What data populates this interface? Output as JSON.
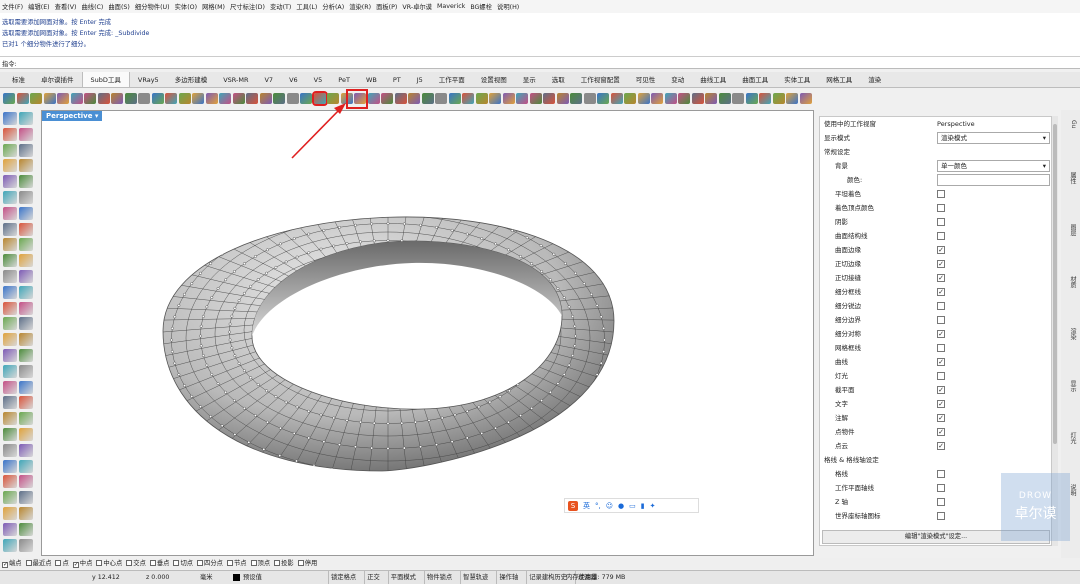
{
  "menu": [
    "文件(F)",
    "编辑(E)",
    "查看(V)",
    "曲线(C)",
    "曲面(S)",
    "细分物件(U)",
    "实体(O)",
    "网格(M)",
    "尺寸标注(D)",
    "变动(T)",
    "工具(L)",
    "分析(A)",
    "渲染(R)",
    "面板(P)",
    "VR-卓尔谟",
    "Maverick",
    "BG螺栓",
    "说明(H)"
  ],
  "command_history": [
    "选取需要添加网面对象。按 Enter 完成",
    "选取需要添加网面对象。按 Enter 完成: _Subdivide",
    "已对1 个细分物件进行了细分。"
  ],
  "command_prompt": "指令:",
  "tabs": [
    "标准",
    "卓尔谟插件",
    "SubD工具",
    "VRay5",
    "多边形建模",
    "VSR-MR",
    "V7",
    "V6",
    "V5",
    "PeT",
    "WB",
    "PT",
    "J5",
    "工作平面",
    "设置视图",
    "显示",
    "选取",
    "工作视窗配置",
    "可见性",
    "变动",
    "曲线工具",
    "曲面工具",
    "实体工具",
    "网格工具",
    "渲染"
  ],
  "active_tab": "SubD工具",
  "viewport": {
    "title": "Perspective"
  },
  "ime_bar": {
    "label": "英"
  },
  "panel": {
    "viewport_label": "使用中的工作视窗",
    "viewport_value": "Perspective",
    "display_mode_label": "显示模式",
    "display_mode_value": "渲染模式",
    "general_section": "常规设定",
    "background_label": "背景",
    "background_value": "单一颜色",
    "color_label": "颜色:",
    "rows": [
      {
        "label": "平坦着色",
        "checked": false
      },
      {
        "label": "着色顶点颜色",
        "checked": false
      },
      {
        "label": "阴影",
        "checked": false
      },
      {
        "label": "曲面结构线",
        "checked": false
      },
      {
        "label": "曲面边缘",
        "checked": true
      },
      {
        "label": "正切边缘",
        "checked": true
      },
      {
        "label": "正切接缝",
        "checked": true
      },
      {
        "label": "细分框线",
        "checked": true
      },
      {
        "label": "细分锐边",
        "checked": false
      },
      {
        "label": "细分边界",
        "checked": false
      },
      {
        "label": "细分对称",
        "checked": true
      },
      {
        "label": "网格框线",
        "checked": false
      },
      {
        "label": "曲线",
        "checked": true
      },
      {
        "label": "灯光",
        "checked": false
      },
      {
        "label": "截平面",
        "checked": true
      },
      {
        "label": "文字",
        "checked": true
      },
      {
        "label": "注解",
        "checked": true
      },
      {
        "label": "点物件",
        "checked": true
      },
      {
        "label": "点云",
        "checked": true
      }
    ],
    "grid_section": "格线 & 格线轴设定",
    "grid_rows": [
      {
        "label": "格线",
        "checked": false
      },
      {
        "label": "工作平面轴线",
        "checked": false
      },
      {
        "label": "Z 轴",
        "checked": false
      },
      {
        "label": "世界座标轴图标",
        "checked": false
      }
    ],
    "edit_button": "编辑\"渲染模式\"设定..."
  },
  "right_tabs": [
    "Gu",
    "属性",
    "图层",
    "材质",
    "渲染",
    "显示",
    "灯光",
    "说明"
  ],
  "watermark": {
    "line1": "DROW",
    "line2": "卓尔谟"
  },
  "osnap": [
    {
      "label": "端点",
      "checked": true
    },
    {
      "label": "最近点",
      "checked": false
    },
    {
      "label": "点",
      "checked": false
    },
    {
      "label": "中点",
      "checked": true
    },
    {
      "label": "中心点",
      "checked": false
    },
    {
      "label": "交点",
      "checked": false
    },
    {
      "label": "垂点",
      "checked": false
    },
    {
      "label": "切点",
      "checked": false
    },
    {
      "label": "四分点",
      "checked": false
    },
    {
      "label": "节点",
      "checked": false
    },
    {
      "label": "顶点",
      "checked": false
    },
    {
      "label": "投影",
      "checked": false
    },
    {
      "label": "停用",
      "checked": false
    }
  ],
  "status": {
    "coord_y": "y 12.412",
    "coord_z": "z 0.000",
    "unit": "毫米",
    "layer": "预设值",
    "toggles": [
      "锁定格点",
      "正交",
      "平面模式",
      "物件锁点",
      "智慧轨迹",
      "操作轴",
      "记录建构历史",
      "过滤器"
    ],
    "memory": "内存使用量: 779 MB"
  },
  "accent_color": "#e02020"
}
